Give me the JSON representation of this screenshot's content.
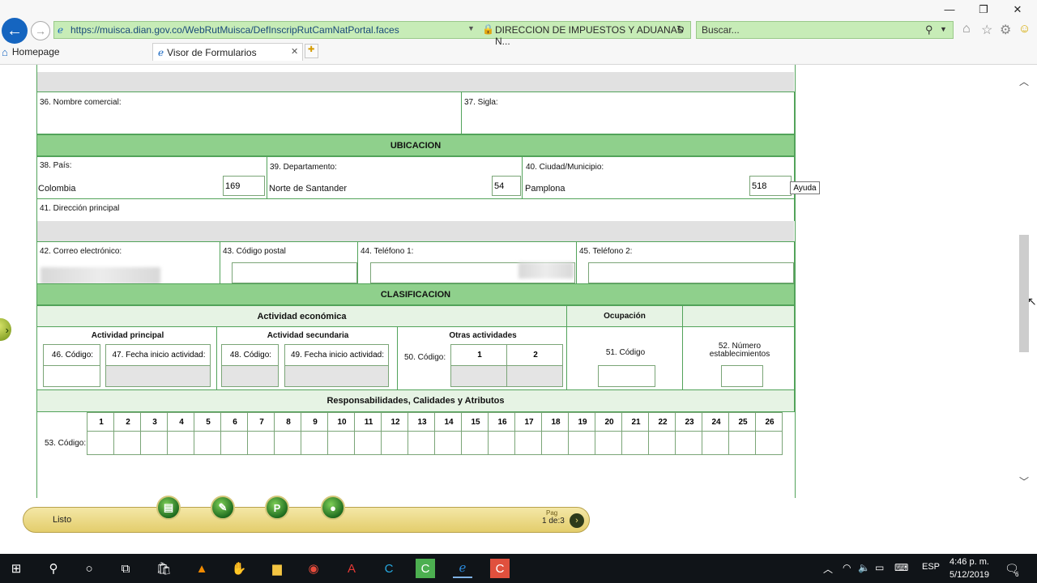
{
  "browser": {
    "url": "https://muisca.dian.gov.co/WebRutMuisca/DefInscripRutCamNatPortal.faces",
    "site_identity": "DIRECCION DE IMPUESTOS Y ADUANAS N...",
    "search_placeholder": "Buscar...",
    "tabs": [
      {
        "label": "Homepage"
      },
      {
        "label": "Visor de Formularios"
      }
    ],
    "close_tab": "✕"
  },
  "form": {
    "f36": "36. Nombre comercial:",
    "f37": "37. Sigla:",
    "ubicacion": "UBICACION",
    "f38": "38. País:",
    "f38_value": "Colombia",
    "f38_code": "169",
    "f39": "39. Departamento:",
    "f39_value": "Norte de Santander",
    "f39_code": "54",
    "f40": "40. Ciudad/Municipio:",
    "f40_value": "Pamplona",
    "f40_code": "518",
    "tooltip": "Ayuda",
    "f41": "41. Dirección principal",
    "f42": "42. Correo electrónico:",
    "f43": "43. Código postal",
    "f44": "44. Teléfono 1:",
    "f45": "45. Teléfono 2:",
    "clasificacion": "CLASIFICACION",
    "actividad_economica": "Actividad económica",
    "ocupacion": "Ocupación",
    "actividad_principal": "Actividad principal",
    "actividad_secundaria": "Actividad secundaria",
    "otras_actividades": "Otras actividades",
    "f46": "46. Código:",
    "f47": "47. Fecha inicio actividad:",
    "f48": "48. Código:",
    "f49": "49. Fecha inicio actividad:",
    "f50": "50. Código:",
    "otras_1": "1",
    "otras_2": "2",
    "f51": "51. Código",
    "f52": "52. Número establecimientos",
    "responsabilidades": "Responsabilidades, Calidades y Atributos",
    "f53": "53. Código:",
    "resp_columns": [
      "1",
      "2",
      "3",
      "4",
      "5",
      "6",
      "7",
      "8",
      "9",
      "10",
      "11",
      "12",
      "13",
      "14",
      "15",
      "16",
      "17",
      "18",
      "19",
      "20",
      "21",
      "22",
      "23",
      "24",
      "25",
      "26"
    ]
  },
  "toolbar": {
    "status": "Listo",
    "page_label": "Pag",
    "page_value": "1 de:3"
  },
  "taskbar": {
    "language": "ESP",
    "time": "4:46 p. m.",
    "date": "5/12/2019",
    "notifications": "6"
  }
}
